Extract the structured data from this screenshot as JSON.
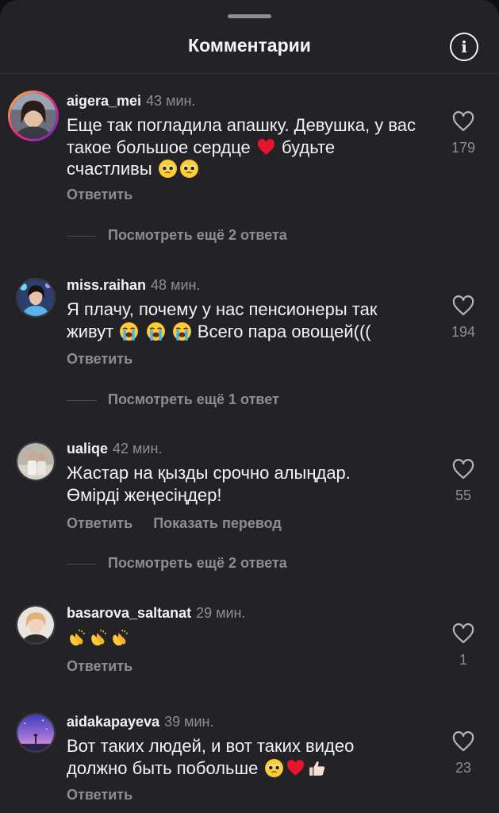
{
  "header": {
    "title": "Комментарии"
  },
  "comments": [
    {
      "username": "aigera_mei",
      "time": "43 мин.",
      "text": "Еще так погладила апашку. Девушка, у вас такое большое сердце",
      "text_after_heart": "будьте счастливы",
      "likes": "179",
      "reply_label": "Ответить",
      "view_replies": "Посмотреть ещё 2 ответа"
    },
    {
      "username": "miss.raihan",
      "time": "48 мин.",
      "text_line1": "Я плачу, почему у нас пенсионеры так",
      "text_line2_a": "живут",
      "text_line2_b": "Всего пара овощей(((",
      "likes": "194",
      "reply_label": "Ответить",
      "view_replies": "Посмотреть ещё 1 ответ"
    },
    {
      "username": "ualiqe",
      "time": "42 мин.",
      "text": "Жастар на қызды срочно алыңдар. Өмірді жеңесіңдер!",
      "likes": "55",
      "reply_label": "Ответить",
      "translate_label": "Показать перевод",
      "view_replies": "Посмотреть ещё 2 ответа"
    },
    {
      "username": "basarova_saltanat",
      "time": "29 мин.",
      "likes": "1",
      "reply_label": "Ответить"
    },
    {
      "username": "aidakapayeva",
      "time": "39 мин.",
      "text_line1": "Вот таких людей, и вот таких видео",
      "text_line2": "должно быть побольше",
      "likes": "23",
      "reply_label": "Ответить"
    }
  ],
  "icons": {
    "info": "info-icon",
    "like": "heart-outline-icon",
    "emoji_pleading": "pleading-face-emoji",
    "emoji_heart": "red-heart-emoji",
    "emoji_crying": "loudly-crying-face-emoji",
    "emoji_clap": "clapping-hands-emoji",
    "emoji_thumbs": "thumbs-up-emoji"
  },
  "colors": {
    "background": "#232327",
    "text_primary": "#f2f2f4",
    "text_secondary": "#8d8d93",
    "heart": "#e5152b"
  }
}
